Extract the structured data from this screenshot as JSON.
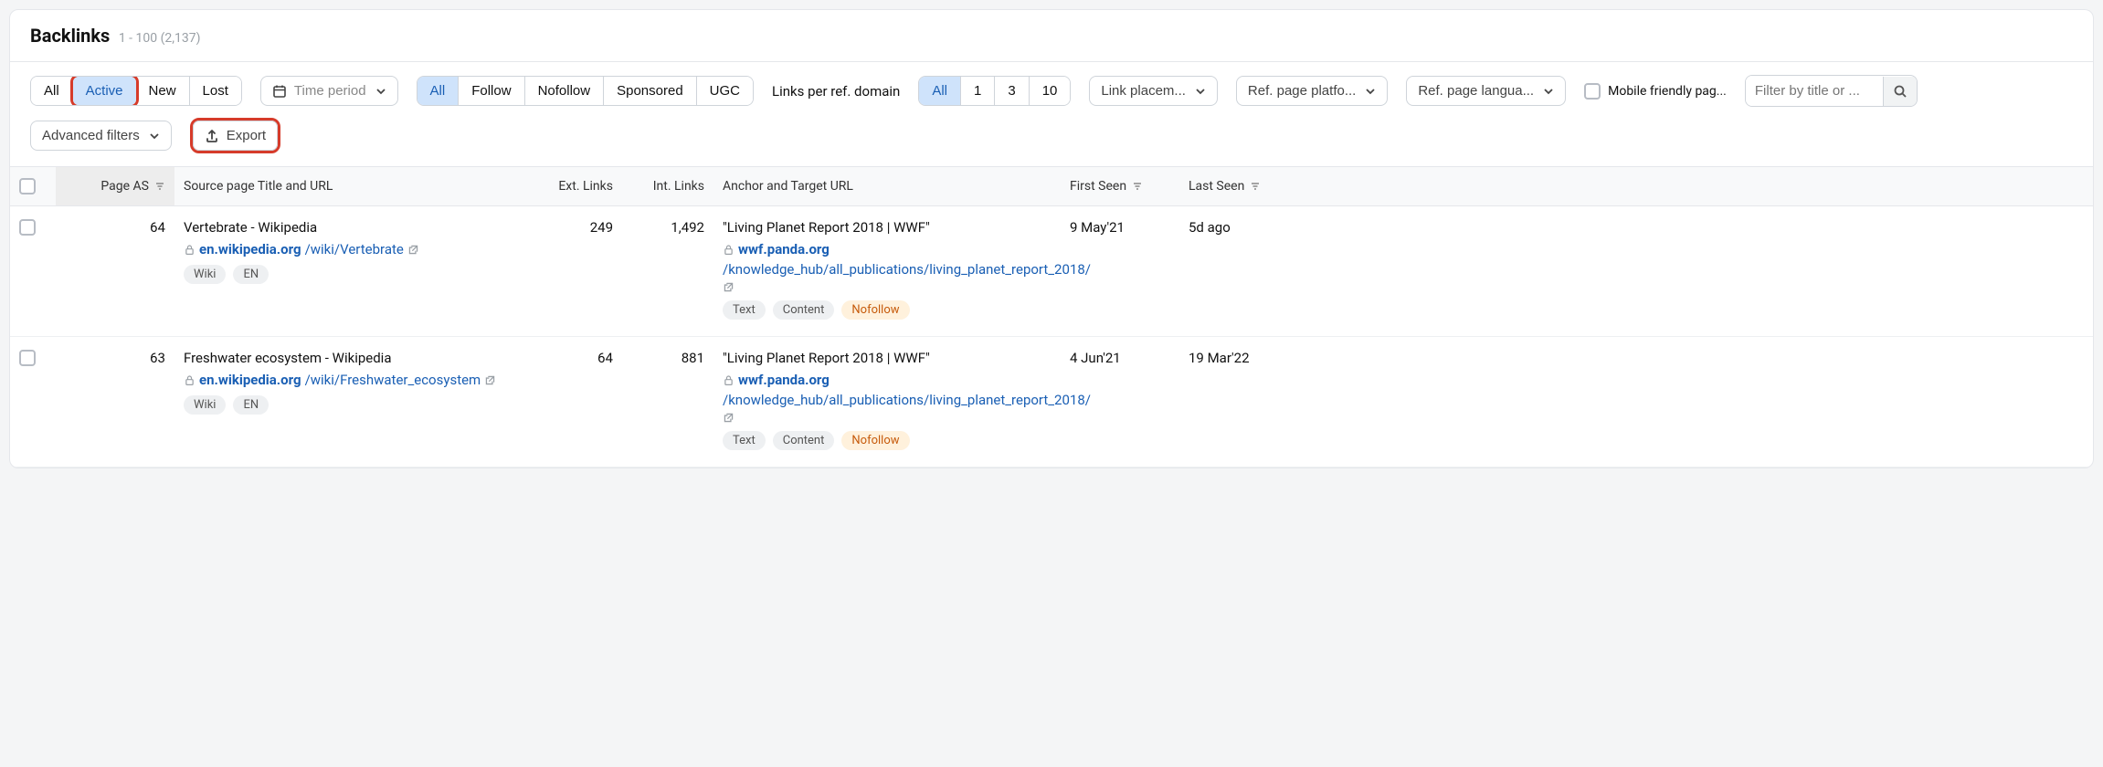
{
  "header": {
    "title": "Backlinks",
    "range": "1 - 100 (2,137)"
  },
  "filters": {
    "status": {
      "options": [
        "All",
        "Active",
        "New",
        "Lost"
      ],
      "active": "Active"
    },
    "time_period": {
      "label": "Time period"
    },
    "link_type": {
      "options": [
        "All",
        "Follow",
        "Nofollow",
        "Sponsored",
        "UGC"
      ],
      "active": "All"
    },
    "links_per_domain": {
      "label": "Links per ref. domain",
      "options": [
        "All",
        "1",
        "3",
        "10"
      ],
      "active": "All"
    },
    "link_placement": "Link placem...",
    "ref_page_platform": "Ref. page platfo...",
    "ref_page_language": "Ref. page langua...",
    "mobile_friendly": "Mobile friendly pag...",
    "search_placeholder": "Filter by title or ...",
    "advanced_filters": "Advanced filters",
    "export": "Export"
  },
  "columns": {
    "page_as": "Page AS",
    "source": "Source page Title and URL",
    "ext_links": "Ext. Links",
    "int_links": "Int. Links",
    "anchor": "Anchor and Target URL",
    "first_seen": "First Seen",
    "last_seen": "Last Seen"
  },
  "rows": [
    {
      "page_as": "64",
      "source_title": "Vertebrate - Wikipedia",
      "source_domain": "en.wikipedia.org",
      "source_path": "/wiki/Vertebrate",
      "source_tags": [
        "Wiki",
        "EN"
      ],
      "ext_links": "249",
      "int_links": "1,492",
      "anchor_text": "\"Living Planet Report 2018 | WWF\"",
      "target_domain": "wwf.panda.org",
      "target_path": "/knowledge_hub/all_publications/living_planet_report_2018/",
      "anchor_tags": [
        "Text",
        "Content",
        "Nofollow"
      ],
      "first_seen": "9 May'21",
      "last_seen": "5d ago"
    },
    {
      "page_as": "63",
      "source_title": "Freshwater ecosystem - Wikipedia",
      "source_domain": "en.wikipedia.org",
      "source_path": "/wiki/Freshwater_ecosystem",
      "source_tags": [
        "Wiki",
        "EN"
      ],
      "ext_links": "64",
      "int_links": "881",
      "anchor_text": "\"Living Planet Report 2018 | WWF\"",
      "target_domain": "wwf.panda.org",
      "target_path": "/knowledge_hub/all_publications/living_planet_report_2018/",
      "anchor_tags": [
        "Text",
        "Content",
        "Nofollow"
      ],
      "first_seen": "4 Jun'21",
      "last_seen": "19 Mar'22"
    }
  ]
}
